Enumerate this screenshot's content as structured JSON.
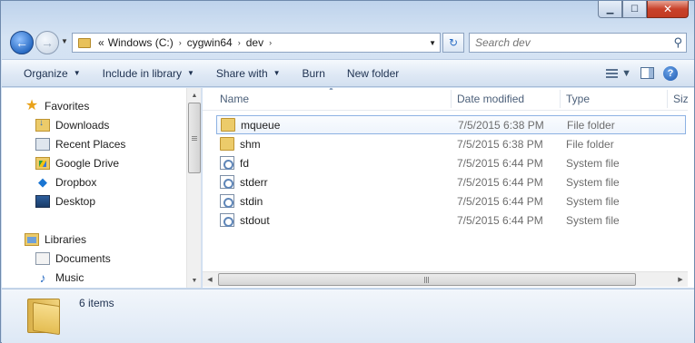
{
  "window": {
    "caption_buttons": {
      "minimize": "▁",
      "maximize": "☐",
      "close": "✕"
    }
  },
  "address_bar": {
    "overflow": "«",
    "breadcrumbs": [
      "Windows (C:)",
      "cygwin64",
      "dev"
    ],
    "separator": "›",
    "dropdown": "▼",
    "refresh": "↻"
  },
  "search": {
    "placeholder": "Search dev",
    "icon": "search-icon"
  },
  "toolbar": {
    "organize": "Organize",
    "include_in_library": "Include in library",
    "share_with": "Share with",
    "burn": "Burn",
    "new_folder": "New folder",
    "help": "?"
  },
  "navigation": {
    "favorites_label": "Favorites",
    "favorites": [
      "Downloads",
      "Recent Places",
      "Google Drive",
      "Dropbox",
      "Desktop"
    ],
    "libraries_label": "Libraries",
    "libraries": [
      "Documents",
      "Music"
    ]
  },
  "file_list": {
    "columns": {
      "name": "Name",
      "date_modified": "Date modified",
      "type": "Type",
      "size": "Siz"
    },
    "sort_indicator": "▲",
    "files": [
      {
        "name": "mqueue",
        "date": "7/5/2015 6:38 PM",
        "type": "File folder",
        "icon": "folder-icon",
        "selected": true
      },
      {
        "name": "shm",
        "date": "7/5/2015 6:38 PM",
        "type": "File folder",
        "icon": "folder-icon",
        "selected": false
      },
      {
        "name": "fd",
        "date": "7/5/2015 6:44 PM",
        "type": "System file",
        "icon": "system-file-icon",
        "selected": false
      },
      {
        "name": "stderr",
        "date": "7/5/2015 6:44 PM",
        "type": "System file",
        "icon": "system-file-icon",
        "selected": false
      },
      {
        "name": "stdin",
        "date": "7/5/2015 6:44 PM",
        "type": "System file",
        "icon": "system-file-icon",
        "selected": false
      },
      {
        "name": "stdout",
        "date": "7/5/2015 6:44 PM",
        "type": "System file",
        "icon": "system-file-icon",
        "selected": false
      }
    ]
  },
  "details_pane": {
    "item_count": "6 items"
  }
}
